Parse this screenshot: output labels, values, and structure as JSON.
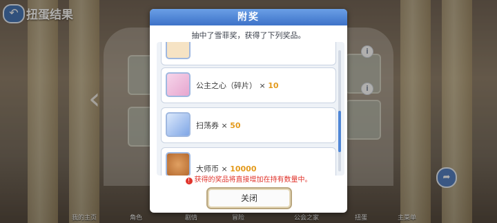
{
  "screen": {
    "title": "扭蛋结果"
  },
  "dialog": {
    "header": "附奖",
    "subtitle": "抽中了雪菲奖，获得了下列奖品。",
    "items": [
      {
        "name": "",
        "qty_label": "",
        "qty": "",
        "icon": "reward-icon"
      },
      {
        "name": "公主之心（碎片）",
        "qty_label": "×",
        "qty": "10",
        "icon": "heart-crystal-icon"
      },
      {
        "name": "扫荡券",
        "qty_label": "×",
        "qty": "50",
        "icon": "ticket-icon"
      },
      {
        "name": "大师币",
        "qty_label": "×",
        "qty": "10000",
        "icon": "master-coin-icon"
      }
    ],
    "note": "获得的奖品将直接增加在持有数量中。",
    "close_label": "关闭"
  },
  "bottom_nav": [
    "我的主页",
    "角色",
    "剧情",
    "冒险",
    "公会之家",
    "扭蛋",
    "主菜单"
  ],
  "colors": {
    "accent": "#3d72c8",
    "quantity": "#e39a1c",
    "warning": "#e0342c"
  }
}
